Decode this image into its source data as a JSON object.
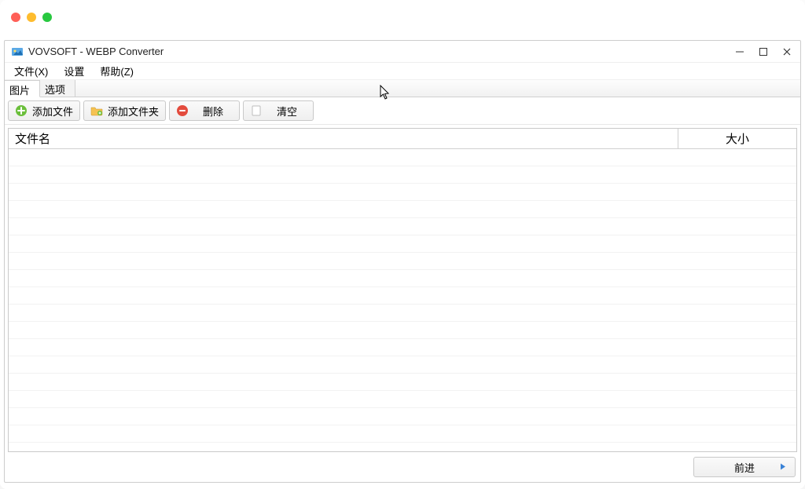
{
  "window": {
    "title": "VOVSOFT - WEBP Converter"
  },
  "menu": {
    "file": "文件(X)",
    "settings": "设置",
    "help": "帮助(Z)"
  },
  "tabs": {
    "image": "图片",
    "options": "选项"
  },
  "toolbar": {
    "add_file": "添加文件",
    "add_folder": "添加文件夹",
    "delete": "删除",
    "clear": "清空"
  },
  "table": {
    "col_filename": "文件名",
    "col_size": "大小"
  },
  "footer": {
    "forward": "前进"
  }
}
